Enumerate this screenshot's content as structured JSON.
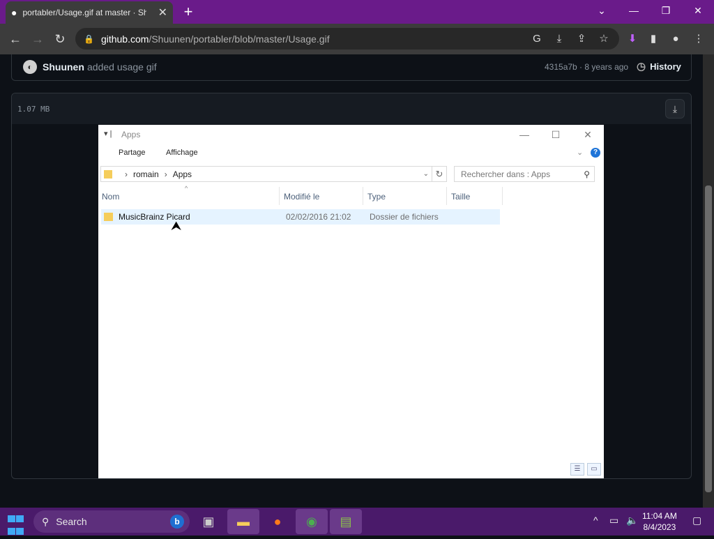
{
  "browser": {
    "tab_title": "portabler/Usage.gif at master · Sh",
    "url_host": "github.com",
    "url_path": "/Shuunen/portabler/blob/master/Usage.gif",
    "new_tab": "+",
    "tab_close": "✕"
  },
  "commit": {
    "author": "Shuunen",
    "message": "added usage gif",
    "meta": "4315a7b · 8 years ago",
    "history_label": "History"
  },
  "file": {
    "size": "1.07 MB"
  },
  "explorer": {
    "title": "Apps",
    "ribbon_tabs": [
      "Partage",
      "Affichage"
    ],
    "breadcrumb": [
      "romain",
      "Apps"
    ],
    "search_placeholder": "Rechercher dans : Apps",
    "columns": [
      "Nom",
      "Modifié le",
      "Type",
      "Taille"
    ],
    "rows": [
      {
        "name": "MusicBrainz Picard",
        "modified": "02/02/2016 21:02",
        "type": "Dossier de fichiers",
        "size": ""
      }
    ]
  },
  "taskbar": {
    "search_label": "Search",
    "time": "11:04 AM",
    "date": "8/4/2023"
  },
  "colors": {
    "tabstrip": "#6a1b8a",
    "taskbar": "#4a1a6a",
    "page_bg": "#0d1117",
    "selected_row": "#e5f3ff"
  }
}
